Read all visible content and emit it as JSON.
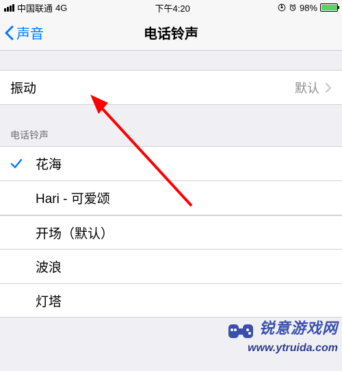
{
  "status": {
    "carrier": "中国联通",
    "network": "4G",
    "time": "下午4:20",
    "battery_pct": "98%"
  },
  "nav": {
    "back_label": "声音",
    "title": "电话铃声"
  },
  "vibration": {
    "label": "振动",
    "value": "默认"
  },
  "ringtones": {
    "header": "电话铃声",
    "items": [
      {
        "label": "花海",
        "selected": true
      },
      {
        "label": "Hari - 可爱颂",
        "selected": false
      },
      {
        "label": "开场（默认）",
        "selected": false
      },
      {
        "label": "波浪",
        "selected": false
      },
      {
        "label": "灯塔",
        "selected": false
      }
    ]
  },
  "watermark": {
    "brand": "锐意游戏网",
    "url": "www.ytruida.com"
  }
}
